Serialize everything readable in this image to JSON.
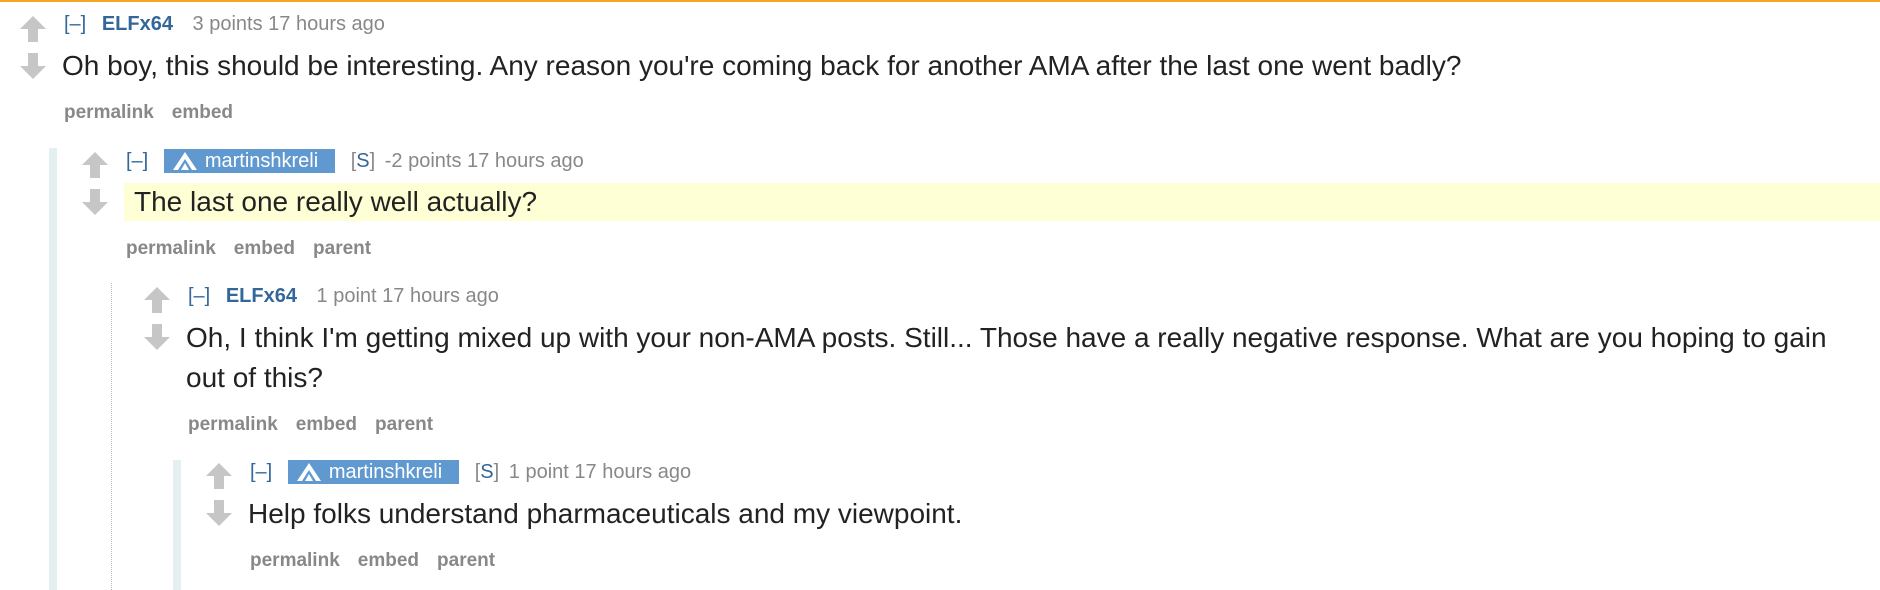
{
  "comments": [
    {
      "collapse": "[–]",
      "author": "ELFx64",
      "score": "3 points",
      "time": "17 hours ago",
      "body": "Oh boy, this should be interesting. Any reason you're coming back for another AMA after the last one went badly?",
      "buttons": [
        "permalink",
        "embed"
      ]
    },
    {
      "collapse": "[–]",
      "author": "martinshkreli",
      "submitter_tag": "S",
      "score": "-2 points",
      "time": "17 hours ago",
      "body": "The last one really well actually?",
      "buttons": [
        "permalink",
        "embed",
        "parent"
      ]
    },
    {
      "collapse": "[–]",
      "author": "ELFx64",
      "score": "1 point",
      "time": "17 hours ago",
      "body": "Oh, I think I'm getting mixed up with your non-AMA posts. Still... Those have a really negative response. What are you hoping to gain out of this?",
      "buttons": [
        "permalink",
        "embed",
        "parent"
      ]
    },
    {
      "collapse": "[–]",
      "author": "martinshkreli",
      "submitter_tag": "S",
      "score": "1 point",
      "time": "17 hours ago",
      "body": "Help folks understand pharmaceuticals and my viewpoint.",
      "buttons": [
        "permalink",
        "embed",
        "parent"
      ]
    }
  ],
  "colors": {
    "top_border": "#f5a623",
    "author_link": "#336699",
    "op_flair_bg": "#5f99cf",
    "highlight_bg": "#ffffd5",
    "meta_gray": "#888888",
    "arrow_gray": "#c6c6c6",
    "thread_line": "#e3eff0"
  },
  "icons": {
    "upvote": "upvote-arrow-icon",
    "downvote": "downvote-arrow-icon",
    "op_logo": "op-flair-logo-icon"
  }
}
